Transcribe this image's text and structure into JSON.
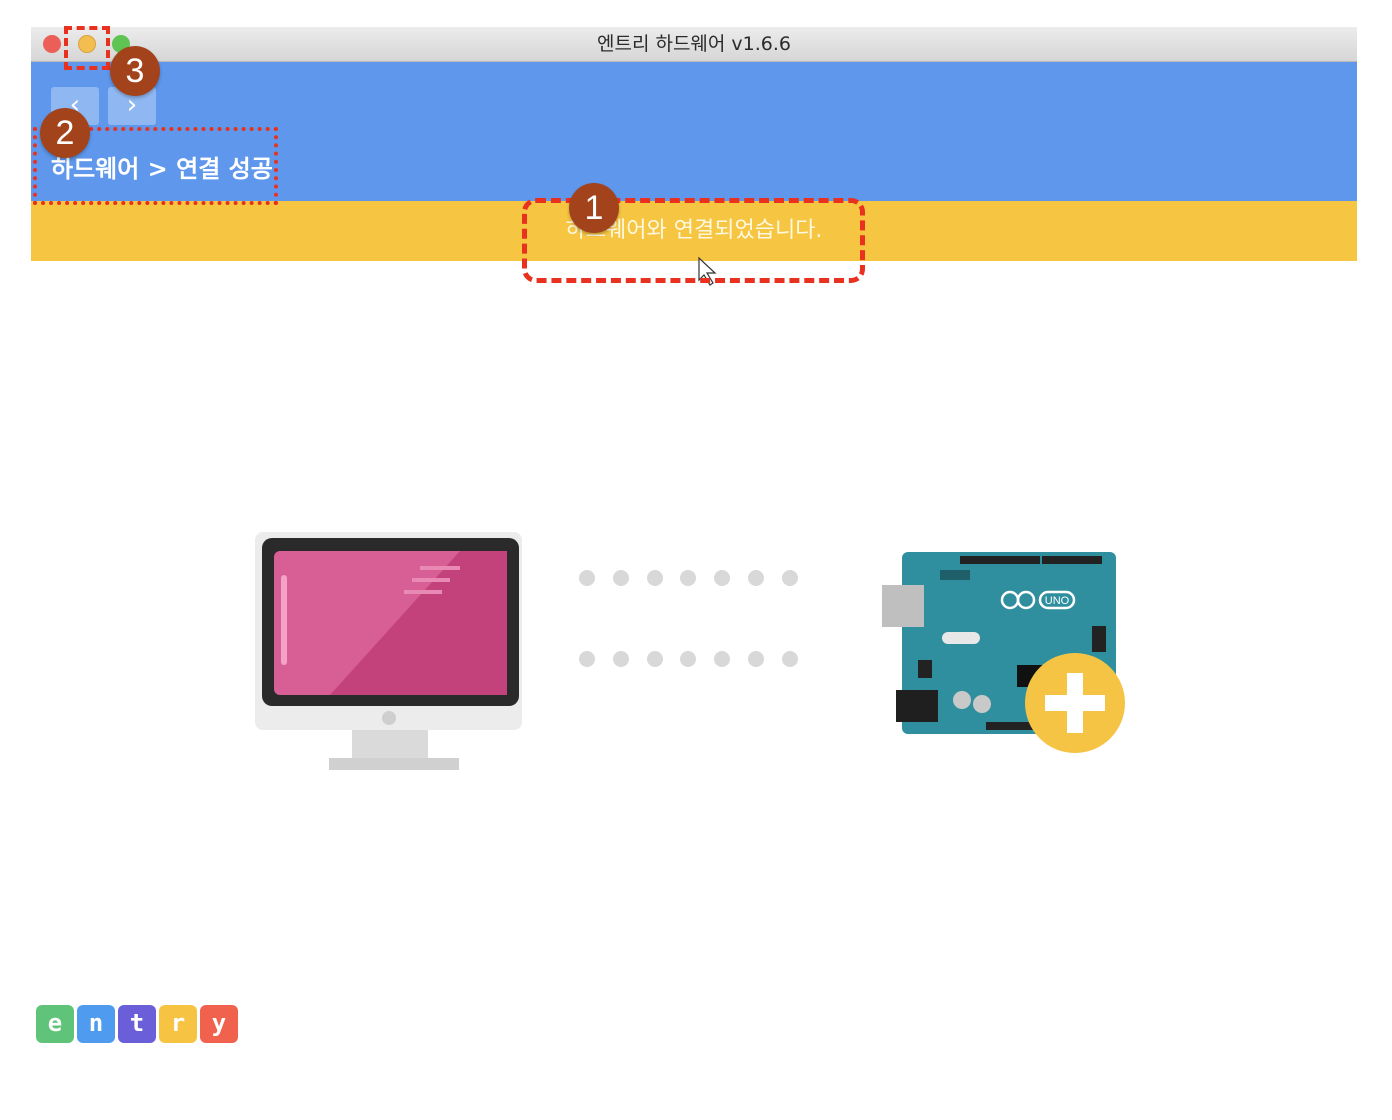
{
  "window": {
    "title": "엔트리 하드웨어 v1.6.6",
    "traffic_lights": {
      "close": "close-icon",
      "minimize": "minimize-icon",
      "maximize": "maximize-icon"
    }
  },
  "nav": {
    "back_icon": "chevron-left-icon",
    "back_glyph": "‹",
    "forward_icon": "chevron-right-icon",
    "forward_glyph": "›"
  },
  "breadcrumb": "하드웨어 > 연결 성공",
  "status_banner": "하드웨어와 연결되었습니다.",
  "illustration": {
    "computer_icon": "monitor-icon",
    "board_icon": "arduino-uno-board-icon",
    "board_logo_text": "UNO",
    "add_icon": "plus-icon"
  },
  "logo": {
    "letters": [
      "e",
      "n",
      "t",
      "r",
      "y"
    ],
    "colors": [
      "#5fc47a",
      "#4f9bef",
      "#6a5fd8",
      "#f6c343",
      "#f0624d"
    ]
  },
  "annotations": [
    {
      "number": "1",
      "target": "status-banner"
    },
    {
      "number": "2",
      "target": "breadcrumb"
    },
    {
      "number": "3",
      "target": "minimize-button"
    }
  ],
  "colors": {
    "header": "#5e97ec",
    "banner": "#f6c643",
    "annotation_box": "#e8321f",
    "annotation_badge": "#a2431c"
  }
}
